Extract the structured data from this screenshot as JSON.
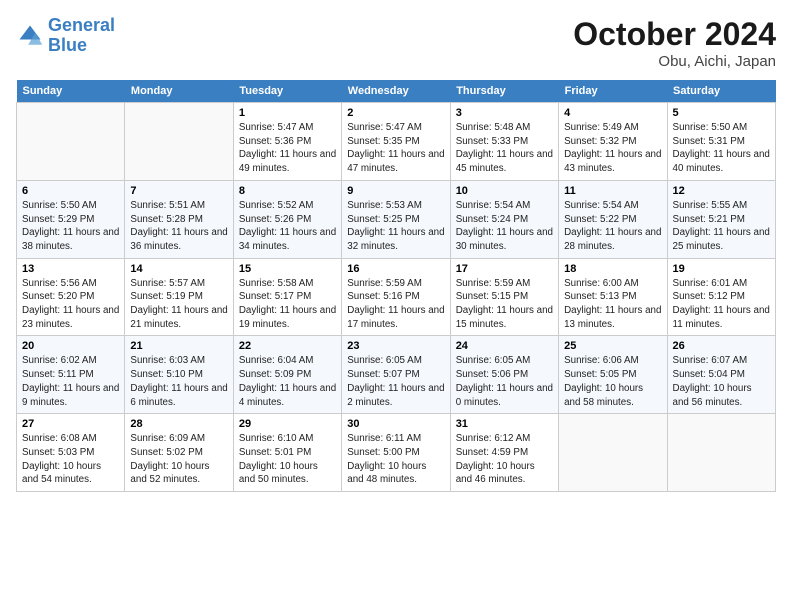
{
  "header": {
    "logo_line1": "General",
    "logo_line2": "Blue",
    "month": "October 2024",
    "location": "Obu, Aichi, Japan"
  },
  "weekdays": [
    "Sunday",
    "Monday",
    "Tuesday",
    "Wednesday",
    "Thursday",
    "Friday",
    "Saturday"
  ],
  "weeks": [
    [
      {
        "day": "",
        "info": ""
      },
      {
        "day": "",
        "info": ""
      },
      {
        "day": "1",
        "info": "Sunrise: 5:47 AM\nSunset: 5:36 PM\nDaylight: 11 hours and 49 minutes."
      },
      {
        "day": "2",
        "info": "Sunrise: 5:47 AM\nSunset: 5:35 PM\nDaylight: 11 hours and 47 minutes."
      },
      {
        "day": "3",
        "info": "Sunrise: 5:48 AM\nSunset: 5:33 PM\nDaylight: 11 hours and 45 minutes."
      },
      {
        "day": "4",
        "info": "Sunrise: 5:49 AM\nSunset: 5:32 PM\nDaylight: 11 hours and 43 minutes."
      },
      {
        "day": "5",
        "info": "Sunrise: 5:50 AM\nSunset: 5:31 PM\nDaylight: 11 hours and 40 minutes."
      }
    ],
    [
      {
        "day": "6",
        "info": "Sunrise: 5:50 AM\nSunset: 5:29 PM\nDaylight: 11 hours and 38 minutes."
      },
      {
        "day": "7",
        "info": "Sunrise: 5:51 AM\nSunset: 5:28 PM\nDaylight: 11 hours and 36 minutes."
      },
      {
        "day": "8",
        "info": "Sunrise: 5:52 AM\nSunset: 5:26 PM\nDaylight: 11 hours and 34 minutes."
      },
      {
        "day": "9",
        "info": "Sunrise: 5:53 AM\nSunset: 5:25 PM\nDaylight: 11 hours and 32 minutes."
      },
      {
        "day": "10",
        "info": "Sunrise: 5:54 AM\nSunset: 5:24 PM\nDaylight: 11 hours and 30 minutes."
      },
      {
        "day": "11",
        "info": "Sunrise: 5:54 AM\nSunset: 5:22 PM\nDaylight: 11 hours and 28 minutes."
      },
      {
        "day": "12",
        "info": "Sunrise: 5:55 AM\nSunset: 5:21 PM\nDaylight: 11 hours and 25 minutes."
      }
    ],
    [
      {
        "day": "13",
        "info": "Sunrise: 5:56 AM\nSunset: 5:20 PM\nDaylight: 11 hours and 23 minutes."
      },
      {
        "day": "14",
        "info": "Sunrise: 5:57 AM\nSunset: 5:19 PM\nDaylight: 11 hours and 21 minutes."
      },
      {
        "day": "15",
        "info": "Sunrise: 5:58 AM\nSunset: 5:17 PM\nDaylight: 11 hours and 19 minutes."
      },
      {
        "day": "16",
        "info": "Sunrise: 5:59 AM\nSunset: 5:16 PM\nDaylight: 11 hours and 17 minutes."
      },
      {
        "day": "17",
        "info": "Sunrise: 5:59 AM\nSunset: 5:15 PM\nDaylight: 11 hours and 15 minutes."
      },
      {
        "day": "18",
        "info": "Sunrise: 6:00 AM\nSunset: 5:13 PM\nDaylight: 11 hours and 13 minutes."
      },
      {
        "day": "19",
        "info": "Sunrise: 6:01 AM\nSunset: 5:12 PM\nDaylight: 11 hours and 11 minutes."
      }
    ],
    [
      {
        "day": "20",
        "info": "Sunrise: 6:02 AM\nSunset: 5:11 PM\nDaylight: 11 hours and 9 minutes."
      },
      {
        "day": "21",
        "info": "Sunrise: 6:03 AM\nSunset: 5:10 PM\nDaylight: 11 hours and 6 minutes."
      },
      {
        "day": "22",
        "info": "Sunrise: 6:04 AM\nSunset: 5:09 PM\nDaylight: 11 hours and 4 minutes."
      },
      {
        "day": "23",
        "info": "Sunrise: 6:05 AM\nSunset: 5:07 PM\nDaylight: 11 hours and 2 minutes."
      },
      {
        "day": "24",
        "info": "Sunrise: 6:05 AM\nSunset: 5:06 PM\nDaylight: 11 hours and 0 minutes."
      },
      {
        "day": "25",
        "info": "Sunrise: 6:06 AM\nSunset: 5:05 PM\nDaylight: 10 hours and 58 minutes."
      },
      {
        "day": "26",
        "info": "Sunrise: 6:07 AM\nSunset: 5:04 PM\nDaylight: 10 hours and 56 minutes."
      }
    ],
    [
      {
        "day": "27",
        "info": "Sunrise: 6:08 AM\nSunset: 5:03 PM\nDaylight: 10 hours and 54 minutes."
      },
      {
        "day": "28",
        "info": "Sunrise: 6:09 AM\nSunset: 5:02 PM\nDaylight: 10 hours and 52 minutes."
      },
      {
        "day": "29",
        "info": "Sunrise: 6:10 AM\nSunset: 5:01 PM\nDaylight: 10 hours and 50 minutes."
      },
      {
        "day": "30",
        "info": "Sunrise: 6:11 AM\nSunset: 5:00 PM\nDaylight: 10 hours and 48 minutes."
      },
      {
        "day": "31",
        "info": "Sunrise: 6:12 AM\nSunset: 4:59 PM\nDaylight: 10 hours and 46 minutes."
      },
      {
        "day": "",
        "info": ""
      },
      {
        "day": "",
        "info": ""
      }
    ]
  ]
}
